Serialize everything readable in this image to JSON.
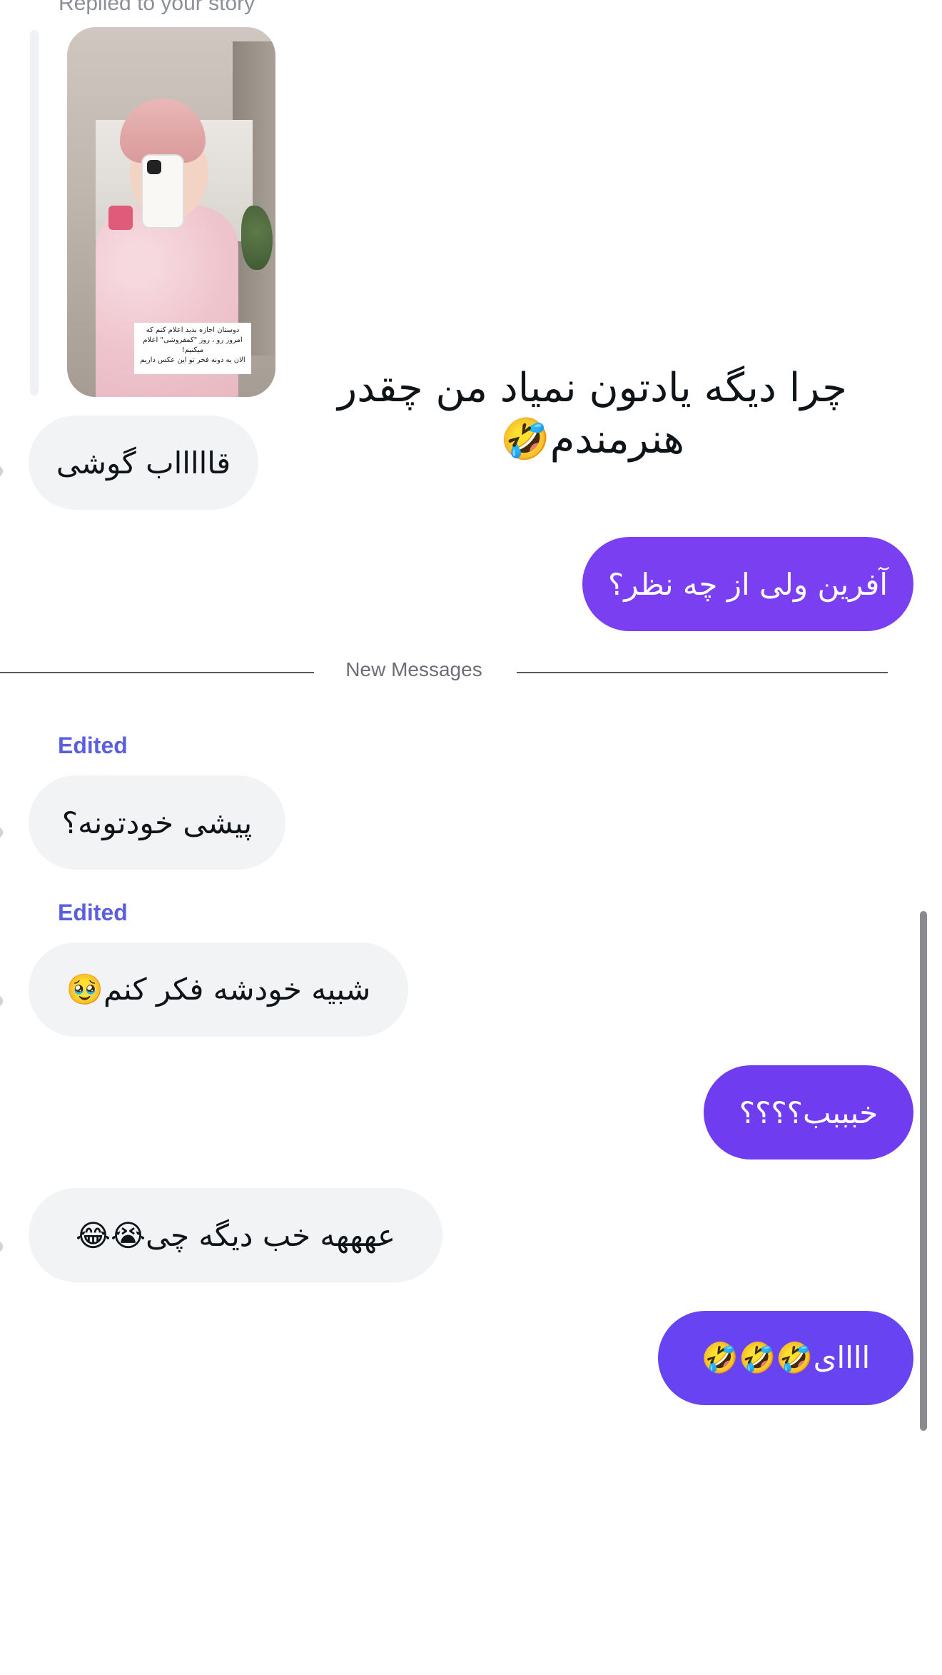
{
  "conversation": {
    "replied_label": "Replied to your story",
    "story": {
      "caption_lines": [
        "دوستان اجازه بدید اعلام کنم که",
        "امروز رو ، روز \"کمفروشی\" اعلام",
        "میکنیم!",
        "الان یه دونه فخر تو این عکس داریم"
      ]
    },
    "story_reply_text": "چرا دیگه یادتون نمیاد من چقدر هنرمندم🤣",
    "messages": [
      {
        "id": "m1",
        "direction": "incoming",
        "text": "قاااااب گوشی"
      },
      {
        "id": "m2",
        "direction": "outgoing",
        "text": "آفرین ولی از چه نظر؟",
        "color": "#7b3ff2"
      },
      {
        "id": "m3",
        "direction": "incoming",
        "edited_label": "Edited",
        "text": "پیشی خودتونه؟"
      },
      {
        "id": "m4",
        "direction": "incoming",
        "edited_label": "Edited",
        "text": "شبیه خودشه فکر کنم🥹"
      },
      {
        "id": "m5",
        "direction": "outgoing",
        "text": "خبببب؟؟؟؟",
        "color": "#6f3cf0"
      },
      {
        "id": "m6",
        "direction": "incoming",
        "text": "عهههه خب دیگه چی😭😂"
      },
      {
        "id": "m7",
        "direction": "outgoing",
        "text": "اااای🤣🤣🤣",
        "color": "#6743f1"
      }
    ],
    "divider_label": "New Messages"
  },
  "colors": {
    "incoming_bubble": "#f2f3f5",
    "edited_label": "#5a5fe0",
    "divider_text": "#6b6f75"
  }
}
